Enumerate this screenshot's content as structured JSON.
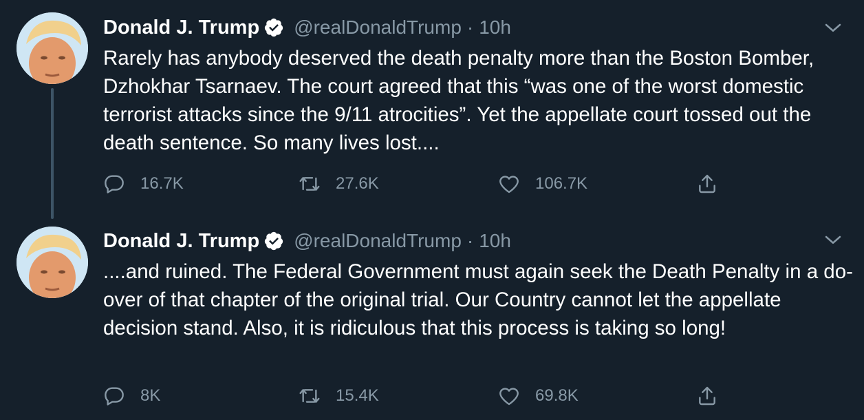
{
  "tweets": [
    {
      "author_name": "Donald J. Trump",
      "handle": "@realDonaldTrump",
      "separator": "·",
      "time": "10h",
      "text": "Rarely has anybody deserved the death penalty more than the Boston Bomber, Dzhokhar Tsarnaev. The court agreed that this “was one of the worst domestic terrorist attacks since the 9/11 atrocities”. Yet the appellate court tossed out the death sentence. So many lives lost....",
      "replies": "16.7K",
      "retweets": "27.6K",
      "likes": "106.7K"
    },
    {
      "author_name": "Donald J. Trump",
      "handle": "@realDonaldTrump",
      "separator": "·",
      "time": "10h",
      "text": "....and ruined. The Federal Government must again seek the Death Penalty in a do-over of that chapter of the original trial. Our Country cannot let the appellate decision stand. Also, it is ridiculous that this process is taking so long!",
      "replies": "8K",
      "retweets": "15.4K",
      "likes": "69.8K"
    }
  ],
  "colors": {
    "background": "#15202b",
    "primary_text": "#ffffff",
    "secondary_text": "#8899a6",
    "verified_badge": "#ffffff",
    "thread_line": "#3d5466"
  },
  "icons": {
    "verified": "verified-badge-icon",
    "more": "chevron-down-icon",
    "reply": "reply-icon",
    "retweet": "retweet-icon",
    "like": "heart-icon",
    "share": "share-icon"
  }
}
